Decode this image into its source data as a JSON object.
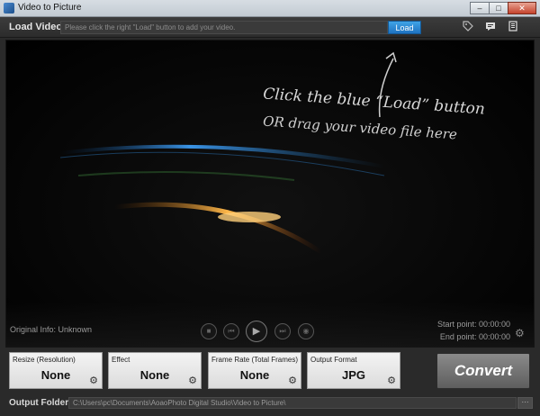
{
  "window": {
    "title": "Video to Picture",
    "min": "–",
    "max": "□",
    "close": "✕"
  },
  "load": {
    "label": "Load Video:",
    "placeholder": "Please click the right \"Load\" button to add your video.",
    "button": "Load"
  },
  "toolbar": {
    "icons": [
      "tag-icon",
      "chat-icon",
      "list-icon"
    ]
  },
  "video": {
    "hint_line1": "Click the blue “Load” button",
    "hint_line2": "OR drag your video file here",
    "original_info": "Original Info: Unknown",
    "start_point": "Start point: 00:00:00",
    "end_point": "End point: 00:00:00"
  },
  "options": [
    {
      "label": "Resize (Resolution)",
      "value": "None"
    },
    {
      "label": "Effect",
      "value": "None"
    },
    {
      "label": "Frame Rate (Total Frames)",
      "value": "None"
    },
    {
      "label": "Output Format",
      "value": "JPG"
    }
  ],
  "convert": {
    "label": "Convert"
  },
  "output": {
    "label": "Output Folder:",
    "path": "C:\\Users\\pc\\Documents\\AoaoPhoto Digital Studio\\Video to Picture\\",
    "browse": "···"
  },
  "colors": {
    "accent": "#2a8ad6",
    "background": "#2a2a2a"
  }
}
